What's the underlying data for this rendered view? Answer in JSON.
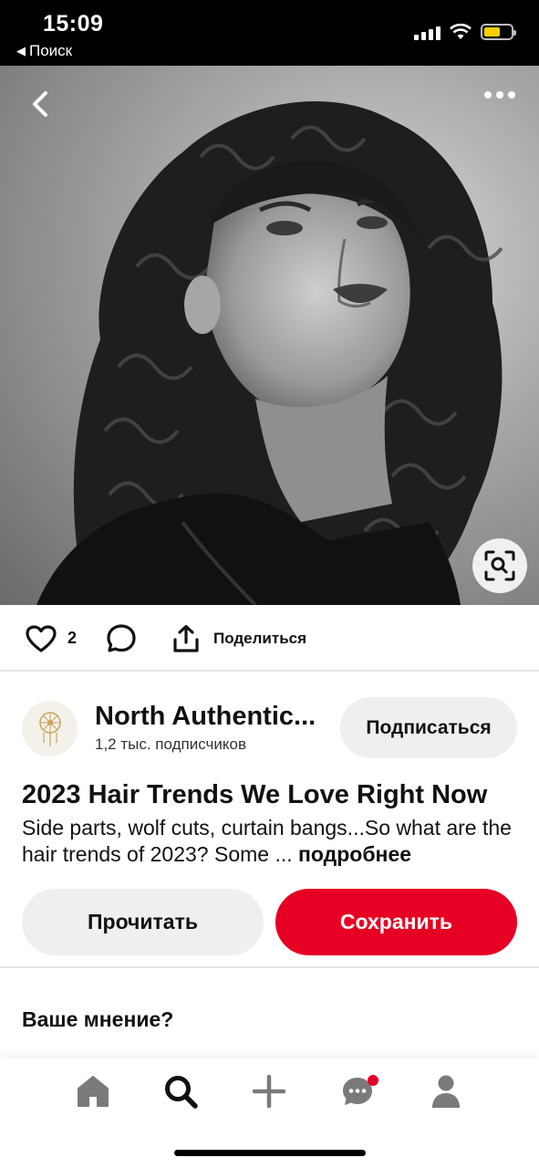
{
  "status_bar": {
    "time": "15:09",
    "back_app_label": "Поиск",
    "back_app_icon": "left-triangle-icon"
  },
  "pin": {
    "image_alt": "",
    "back_icon": "chevron-left-icon",
    "more_icon": "more-dots-icon",
    "lens_icon": "visual-search-icon"
  },
  "actions": {
    "like_count": "2",
    "share_label": "Поделиться"
  },
  "creator": {
    "name": "North Authentic...",
    "followers": "1,2 тыс. подписчиков",
    "subscribe_label": "Подписаться"
  },
  "content": {
    "title": "2023 Hair Trends We Love Right Now",
    "description": "Side parts, wolf cuts, curtain bangs...So what are the hair trends of 2023? Some ... ",
    "more_label": "подробнее"
  },
  "buttons": {
    "read_label": "Прочитать",
    "save_label": "Сохранить"
  },
  "feedback": {
    "heading": "Ваше мнение?"
  },
  "bottom_nav": {
    "items": [
      "home",
      "search",
      "create",
      "messages",
      "profile"
    ],
    "active": "search"
  },
  "colors": {
    "accent": "#e60023",
    "button_gray": "#efefef"
  }
}
